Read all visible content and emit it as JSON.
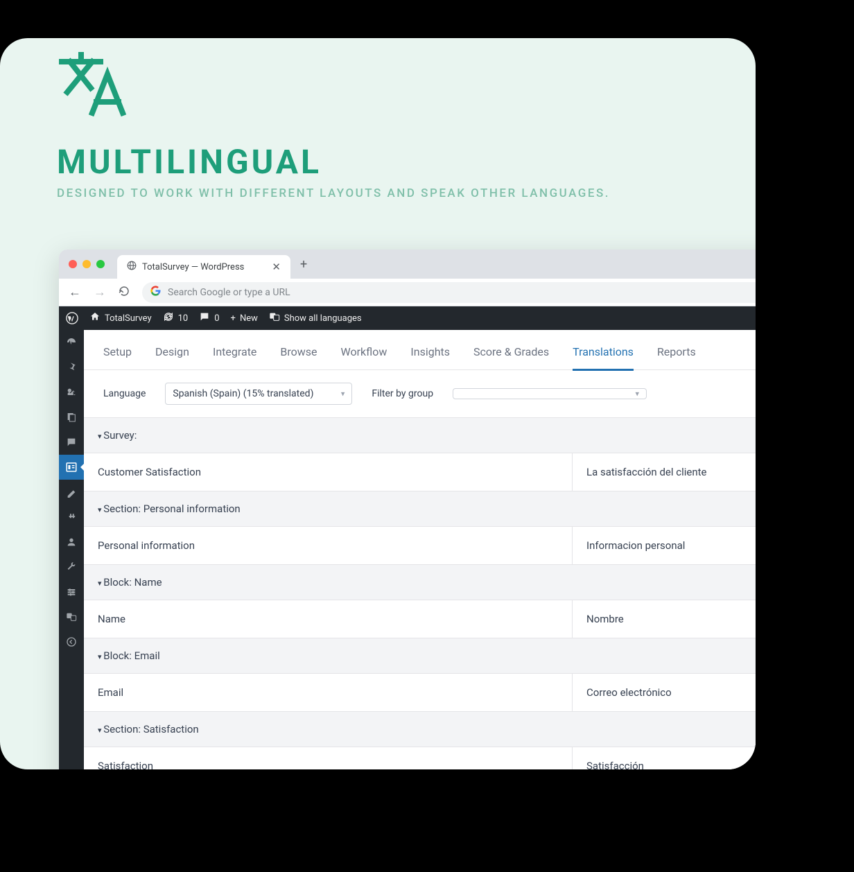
{
  "hero": {
    "title": "MULTILINGUAL",
    "subtitle": "DESIGNED TO WORK WITH DIFFERENT LAYOUTS AND SPEAK OTHER LANGUAGES."
  },
  "browser": {
    "tab_title": "TotalSurvey — WordPress",
    "omnibox_placeholder": "Search Google or type a URL"
  },
  "wp_adminbar": {
    "site_name": "TotalSurvey",
    "updates": "10",
    "comments": "0",
    "new": "New",
    "languages": "Show all languages"
  },
  "tabs": {
    "setup": "Setup",
    "design": "Design",
    "integrate": "Integrate",
    "browse": "Browse",
    "workflow": "Workflow",
    "insights": "Insights",
    "score": "Score & Grades",
    "translations": "Translations",
    "reports": "Reports"
  },
  "filters": {
    "language_label": "Language",
    "language_value": "Spanish (Spain) (15% translated)",
    "group_label": "Filter by group",
    "group_value": ""
  },
  "groups": [
    {
      "header": "Survey:",
      "rows": [
        {
          "source": "Customer Satisfaction",
          "target": "La satisfacción del cliente"
        }
      ]
    },
    {
      "header": "Section: Personal information",
      "rows": [
        {
          "source": "Personal information",
          "target": "Informacion personal"
        }
      ]
    },
    {
      "header": "Block: Name",
      "rows": [
        {
          "source": "Name",
          "target": "Nombre"
        }
      ]
    },
    {
      "header": "Block: Email",
      "rows": [
        {
          "source": "Email",
          "target": "Correo electrónico"
        }
      ]
    },
    {
      "header": "Section: Satisfaction",
      "rows": [
        {
          "source": "Satisfaction",
          "target": "Satisfacción"
        }
      ]
    }
  ]
}
